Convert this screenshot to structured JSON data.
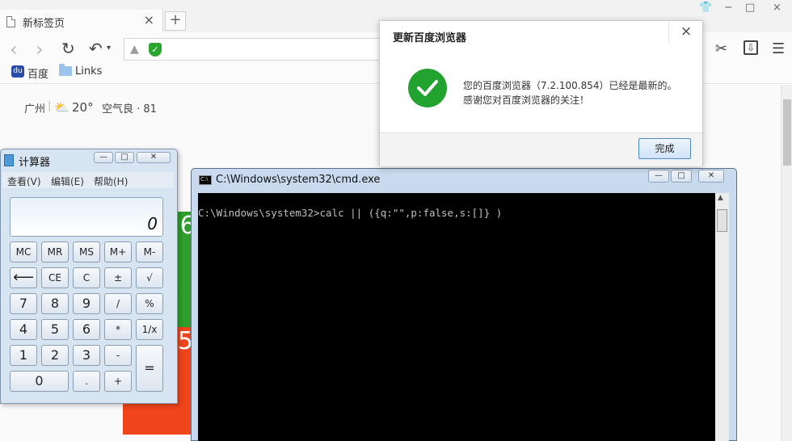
{
  "browser": {
    "tab": {
      "title": "新标签页",
      "close": "×"
    },
    "new_tab": "+",
    "window_controls": [
      "👕",
      "−",
      "□",
      "×"
    ],
    "toolbar_icons": {
      "back": "‹",
      "forward": "›",
      "reload": "↻",
      "undo": "↶",
      "undo_menu": "▾",
      "rocket": "▲",
      "shield": "✓",
      "scissors": "✂",
      "download": "⇩",
      "menu": "☰"
    },
    "bookmarks": [
      {
        "label": "百度",
        "icon": "paw-icon"
      },
      {
        "label": "Links",
        "icon": "folder-icon"
      }
    ]
  },
  "page": {
    "weather": {
      "city": "广州",
      "temperature": "20°",
      "air_quality": "空气良 · 81"
    },
    "banner_text": {
      "green": "i6",
      "red": "5"
    }
  },
  "calculator": {
    "title": "计算器",
    "title_buttons": [
      "—",
      "□",
      "✕"
    ],
    "menu": [
      "查看(V)",
      "编辑(E)",
      "帮助(H)"
    ],
    "display": "0",
    "keys": [
      [
        "MC",
        "MR",
        "MS",
        "M+",
        "M-"
      ],
      [
        "⟵",
        "CE",
        "C",
        "±",
        "√"
      ],
      [
        "7",
        "8",
        "9",
        "/",
        "%"
      ],
      [
        "4",
        "5",
        "6",
        "*",
        "1/x"
      ],
      [
        "1",
        "2",
        "3",
        "-",
        "="
      ],
      [
        "0",
        ".",
        "+"
      ]
    ]
  },
  "cmd": {
    "title": "C:\\Windows\\system32\\cmd.exe",
    "title_buttons": [
      "—",
      "□",
      "✕"
    ],
    "line": "C:\\Windows\\system32>calc || ({q:\"\",p:false,s:[]} )",
    "scroll_arrow": "▲"
  },
  "dialog": {
    "title": "更新百度浏览器",
    "close": "×",
    "message_line1": "您的百度浏览器（7.2.100.854）已经是最新的。",
    "message_line2": "感谢您对百度浏览器的关注！",
    "done_button": "完成"
  },
  "colors": {
    "success": "#22a22e",
    "console_bg": "#000000",
    "console_text": "#c0c0c0",
    "calc_frame": "#d7e4f2"
  }
}
